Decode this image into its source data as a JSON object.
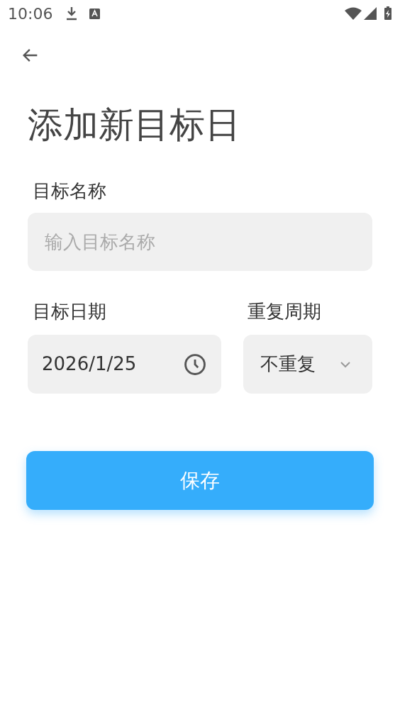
{
  "status_bar": {
    "time": "10:06"
  },
  "title": "添加新目标日",
  "name_field": {
    "label": "目标名称",
    "placeholder": "输入目标名称"
  },
  "date_field": {
    "label": "目标日期",
    "value": "2026/1/25"
  },
  "repeat_field": {
    "label": "重复周期",
    "value": "不重复"
  },
  "save_button": {
    "label": "保存"
  }
}
